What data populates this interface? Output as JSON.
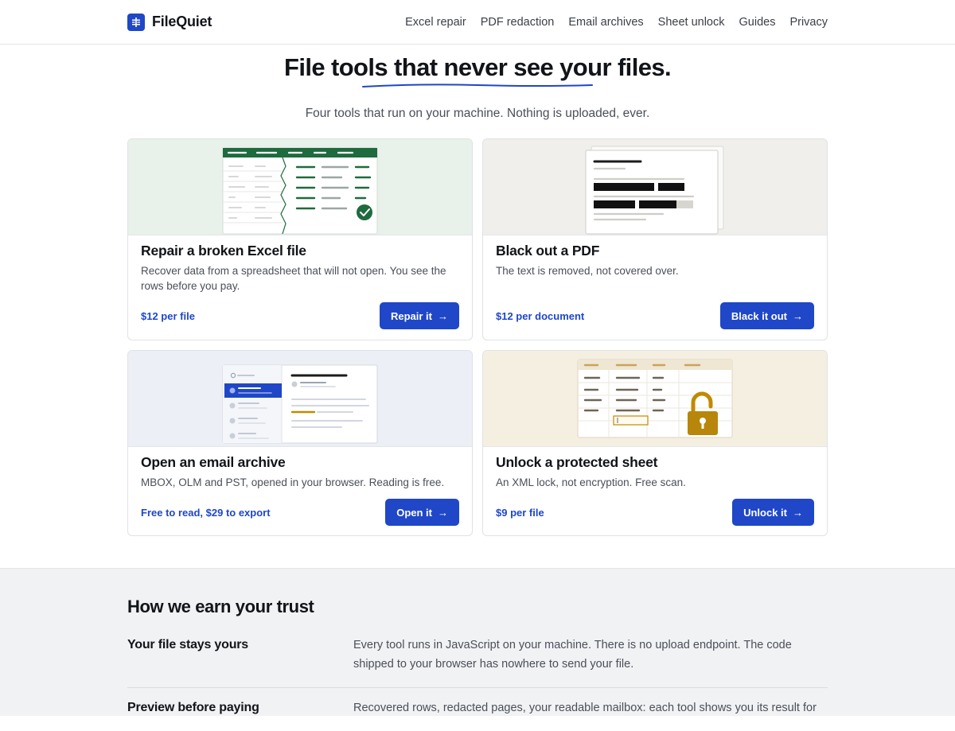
{
  "brand": {
    "name": "FileQuiet",
    "accent": "#1f47c7"
  },
  "nav": [
    {
      "label": "Excel repair"
    },
    {
      "label": "PDF redaction"
    },
    {
      "label": "Email archives"
    },
    {
      "label": "Sheet unlock"
    },
    {
      "label": "Guides"
    },
    {
      "label": "Privacy"
    }
  ],
  "hero": {
    "title": "File tools that never see your files.",
    "subtitle": "Four tools that run on your machine. Nothing is uploaded, ever."
  },
  "cards": [
    {
      "title": "Repair a broken Excel file",
      "desc": "Recover data from a spreadsheet that will not open. You see the rows before you pay.",
      "price": "$12 per file",
      "button": "Repair it",
      "illustration": "spreadsheet-repair-icon"
    },
    {
      "title": "Black out a PDF",
      "desc": "The text is removed, not covered over.",
      "price": "$12 per document",
      "button": "Black it out",
      "illustration": "redacted-document-icon"
    },
    {
      "title": "Open an email archive",
      "desc": "MBOX, OLM and PST, opened in your browser. Reading is free.",
      "price": "Free to read, $29 to export",
      "button": "Open it",
      "illustration": "mailbox-icon"
    },
    {
      "title": "Unlock a protected sheet",
      "desc": "An XML lock, not encryption. Free scan.",
      "price": "$9 per file",
      "button": "Unlock it",
      "illustration": "unlock-sheet-icon"
    }
  ],
  "trust": {
    "heading": "How we earn your trust",
    "items": [
      {
        "label": "Your file stays yours",
        "text": "Every tool runs in JavaScript on your machine. There is no upload endpoint. The code shipped to your browser has nowhere to send your file."
      },
      {
        "label": "Preview before paying",
        "text": "Recovered rows, redacted pages, your readable mailbox: each tool shows you its result for"
      }
    ]
  }
}
